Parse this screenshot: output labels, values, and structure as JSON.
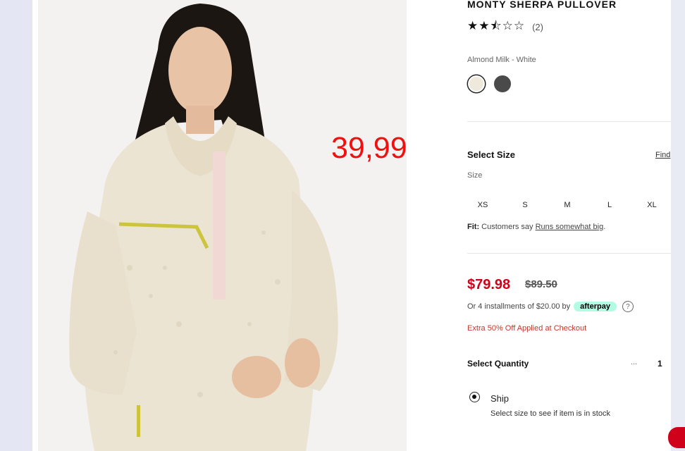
{
  "product": {
    "title": "MONTY SHERPA PULLOVER",
    "stars": "★★⯪☆☆",
    "review_count": "(2)",
    "color_name": "Almond Milk - White",
    "swatches": [
      {
        "name": "almond-milk-white",
        "color": "#efe9dc"
      },
      {
        "name": "dark-grey",
        "color": "#4a4a4a"
      }
    ]
  },
  "overlay_price": "39,99",
  "size": {
    "heading": "Select Size",
    "find_link": "Find",
    "label": "Size",
    "options": [
      "XS",
      "S",
      "M",
      "L",
      "XL"
    ],
    "fit_prefix": "Fit:",
    "fit_text": "Customers say",
    "fit_link": "Runs somewhat big",
    "fit_suffix": "."
  },
  "price": {
    "sale": "$79.98",
    "original": "$89.50",
    "installments_text": "Or 4 installments of $20.00 by",
    "afterpay_label": "afterpay",
    "help_icon": "?",
    "extra_offer": "Extra 50% Off Applied at Checkout"
  },
  "quantity": {
    "label": "Select Quantity",
    "dots": "...",
    "value": "1"
  },
  "fulfillment": {
    "option_label": "Ship",
    "note": "Select size to see if item is in stock"
  },
  "colors": {
    "sale_red": "#d0021b",
    "overlay_red": "#f01010",
    "afterpay_mint": "#b2fce4"
  }
}
